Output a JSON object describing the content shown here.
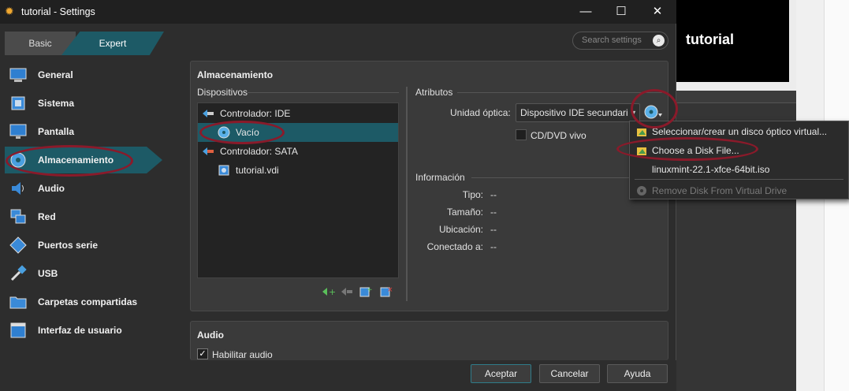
{
  "window": {
    "title": "tutorial - Settings",
    "minimize": "—",
    "maximize": "☐",
    "close": "✕"
  },
  "background": {
    "preview_name": "tutorial"
  },
  "modes": {
    "basic": "Basic",
    "expert": "Expert"
  },
  "search": {
    "placeholder": "Search settings"
  },
  "sidebar": {
    "items": [
      {
        "label": "General",
        "icon": "general-icon"
      },
      {
        "label": "Sistema",
        "icon": "system-icon"
      },
      {
        "label": "Pantalla",
        "icon": "display-icon"
      },
      {
        "label": "Almacenamiento",
        "icon": "storage-icon",
        "active": true
      },
      {
        "label": "Audio",
        "icon": "audio-icon"
      },
      {
        "label": "Red",
        "icon": "network-icon"
      },
      {
        "label": "Puertos serie",
        "icon": "serial-ports-icon"
      },
      {
        "label": "USB",
        "icon": "usb-icon"
      },
      {
        "label": "Carpetas compartidas",
        "icon": "shared-folders-icon"
      },
      {
        "label": "Interfaz de usuario",
        "icon": "user-interface-icon"
      }
    ]
  },
  "storage": {
    "title": "Almacenamiento",
    "devices_label": "Dispositivos",
    "tree": [
      {
        "label": "Controlador: IDE",
        "type": "controller"
      },
      {
        "label": "Vacío",
        "type": "optical",
        "selected": true
      },
      {
        "label": "Controlador: SATA",
        "type": "controller"
      },
      {
        "label": "tutorial.vdi",
        "type": "disk"
      }
    ],
    "attributes_label": "Atributos",
    "optical_drive_label": "Unidad óptica:",
    "optical_drive_value": "Dispositivo IDE secundari",
    "live_cd_label": "CD/DVD vivo",
    "information_label": "Información",
    "info": [
      {
        "key": "Tipo:",
        "value": "--"
      },
      {
        "key": "Tamaño:",
        "value": "--"
      },
      {
        "key": "Ubicación:",
        "value": "--"
      },
      {
        "key": "Conectado a:",
        "value": "--"
      }
    ]
  },
  "audio": {
    "title": "Audio",
    "enable_label": "Habilitar audio",
    "checked_mark": "✓"
  },
  "buttons": {
    "accept": "Aceptar",
    "cancel": "Cancelar",
    "help": "Ayuda"
  },
  "popup_menu": [
    {
      "label": "Seleccionar/crear un disco óptico virtual...",
      "icon": "folder-icon"
    },
    {
      "label": "Choose a Disk File...",
      "icon": "folder-icon"
    },
    {
      "label": "linuxmint-22.1-xfce-64bit.iso",
      "icon": ""
    },
    {
      "label": "Remove Disk From Virtual Drive",
      "icon": "remove-disk-icon",
      "disabled": true
    }
  ],
  "colors": {
    "accent": "#1d5a66",
    "annotation": "#8a1a2a",
    "dialog_bg": "#2d2d2d"
  }
}
